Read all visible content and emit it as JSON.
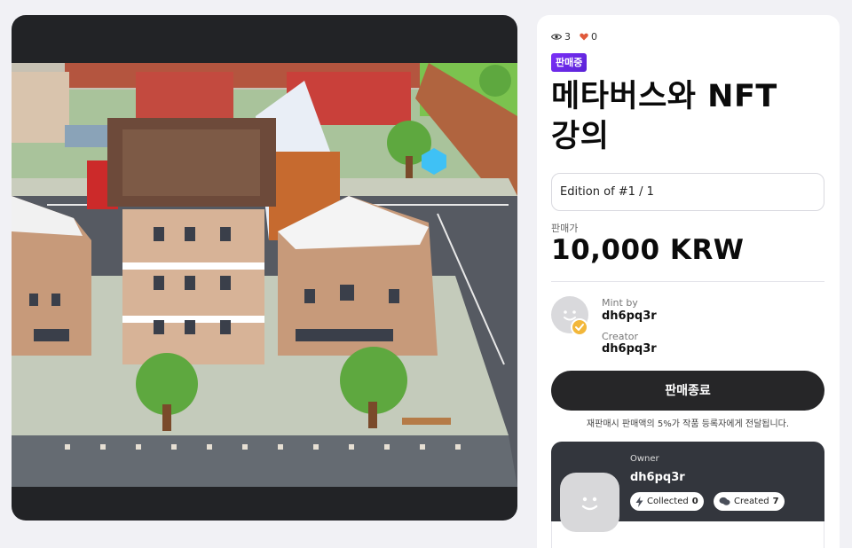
{
  "stats": {
    "views": "3",
    "likes": "0"
  },
  "badge": "판매중",
  "title": "메타버스와 NFT 강의",
  "edition": "Edition of #1 / 1",
  "price": {
    "label": "판매가",
    "value": "10,000 KRW"
  },
  "mint": {
    "label": "Mint by",
    "name": "dh6pq3r"
  },
  "creator": {
    "label": "Creator",
    "name": "dh6pq3r"
  },
  "action": {
    "button": "판매종료",
    "note": "재판매시 판매액의 5%가 작품 등록자에게 전달됩니다."
  },
  "owner": {
    "label": "Owner",
    "name": "dh6pq3r",
    "collected_label": "Collected",
    "collected_count": "0",
    "created_label": "Created",
    "created_count": "7"
  },
  "icons": [
    "eye-icon",
    "heart-icon",
    "verified-badge-icon",
    "lightning-icon",
    "chat-icon"
  ],
  "colors": {
    "badge": "#6a28e8",
    "button": "#262628",
    "owner_card": "#33363d",
    "heart": "#e05a3b",
    "verified": "#f2b73a"
  }
}
